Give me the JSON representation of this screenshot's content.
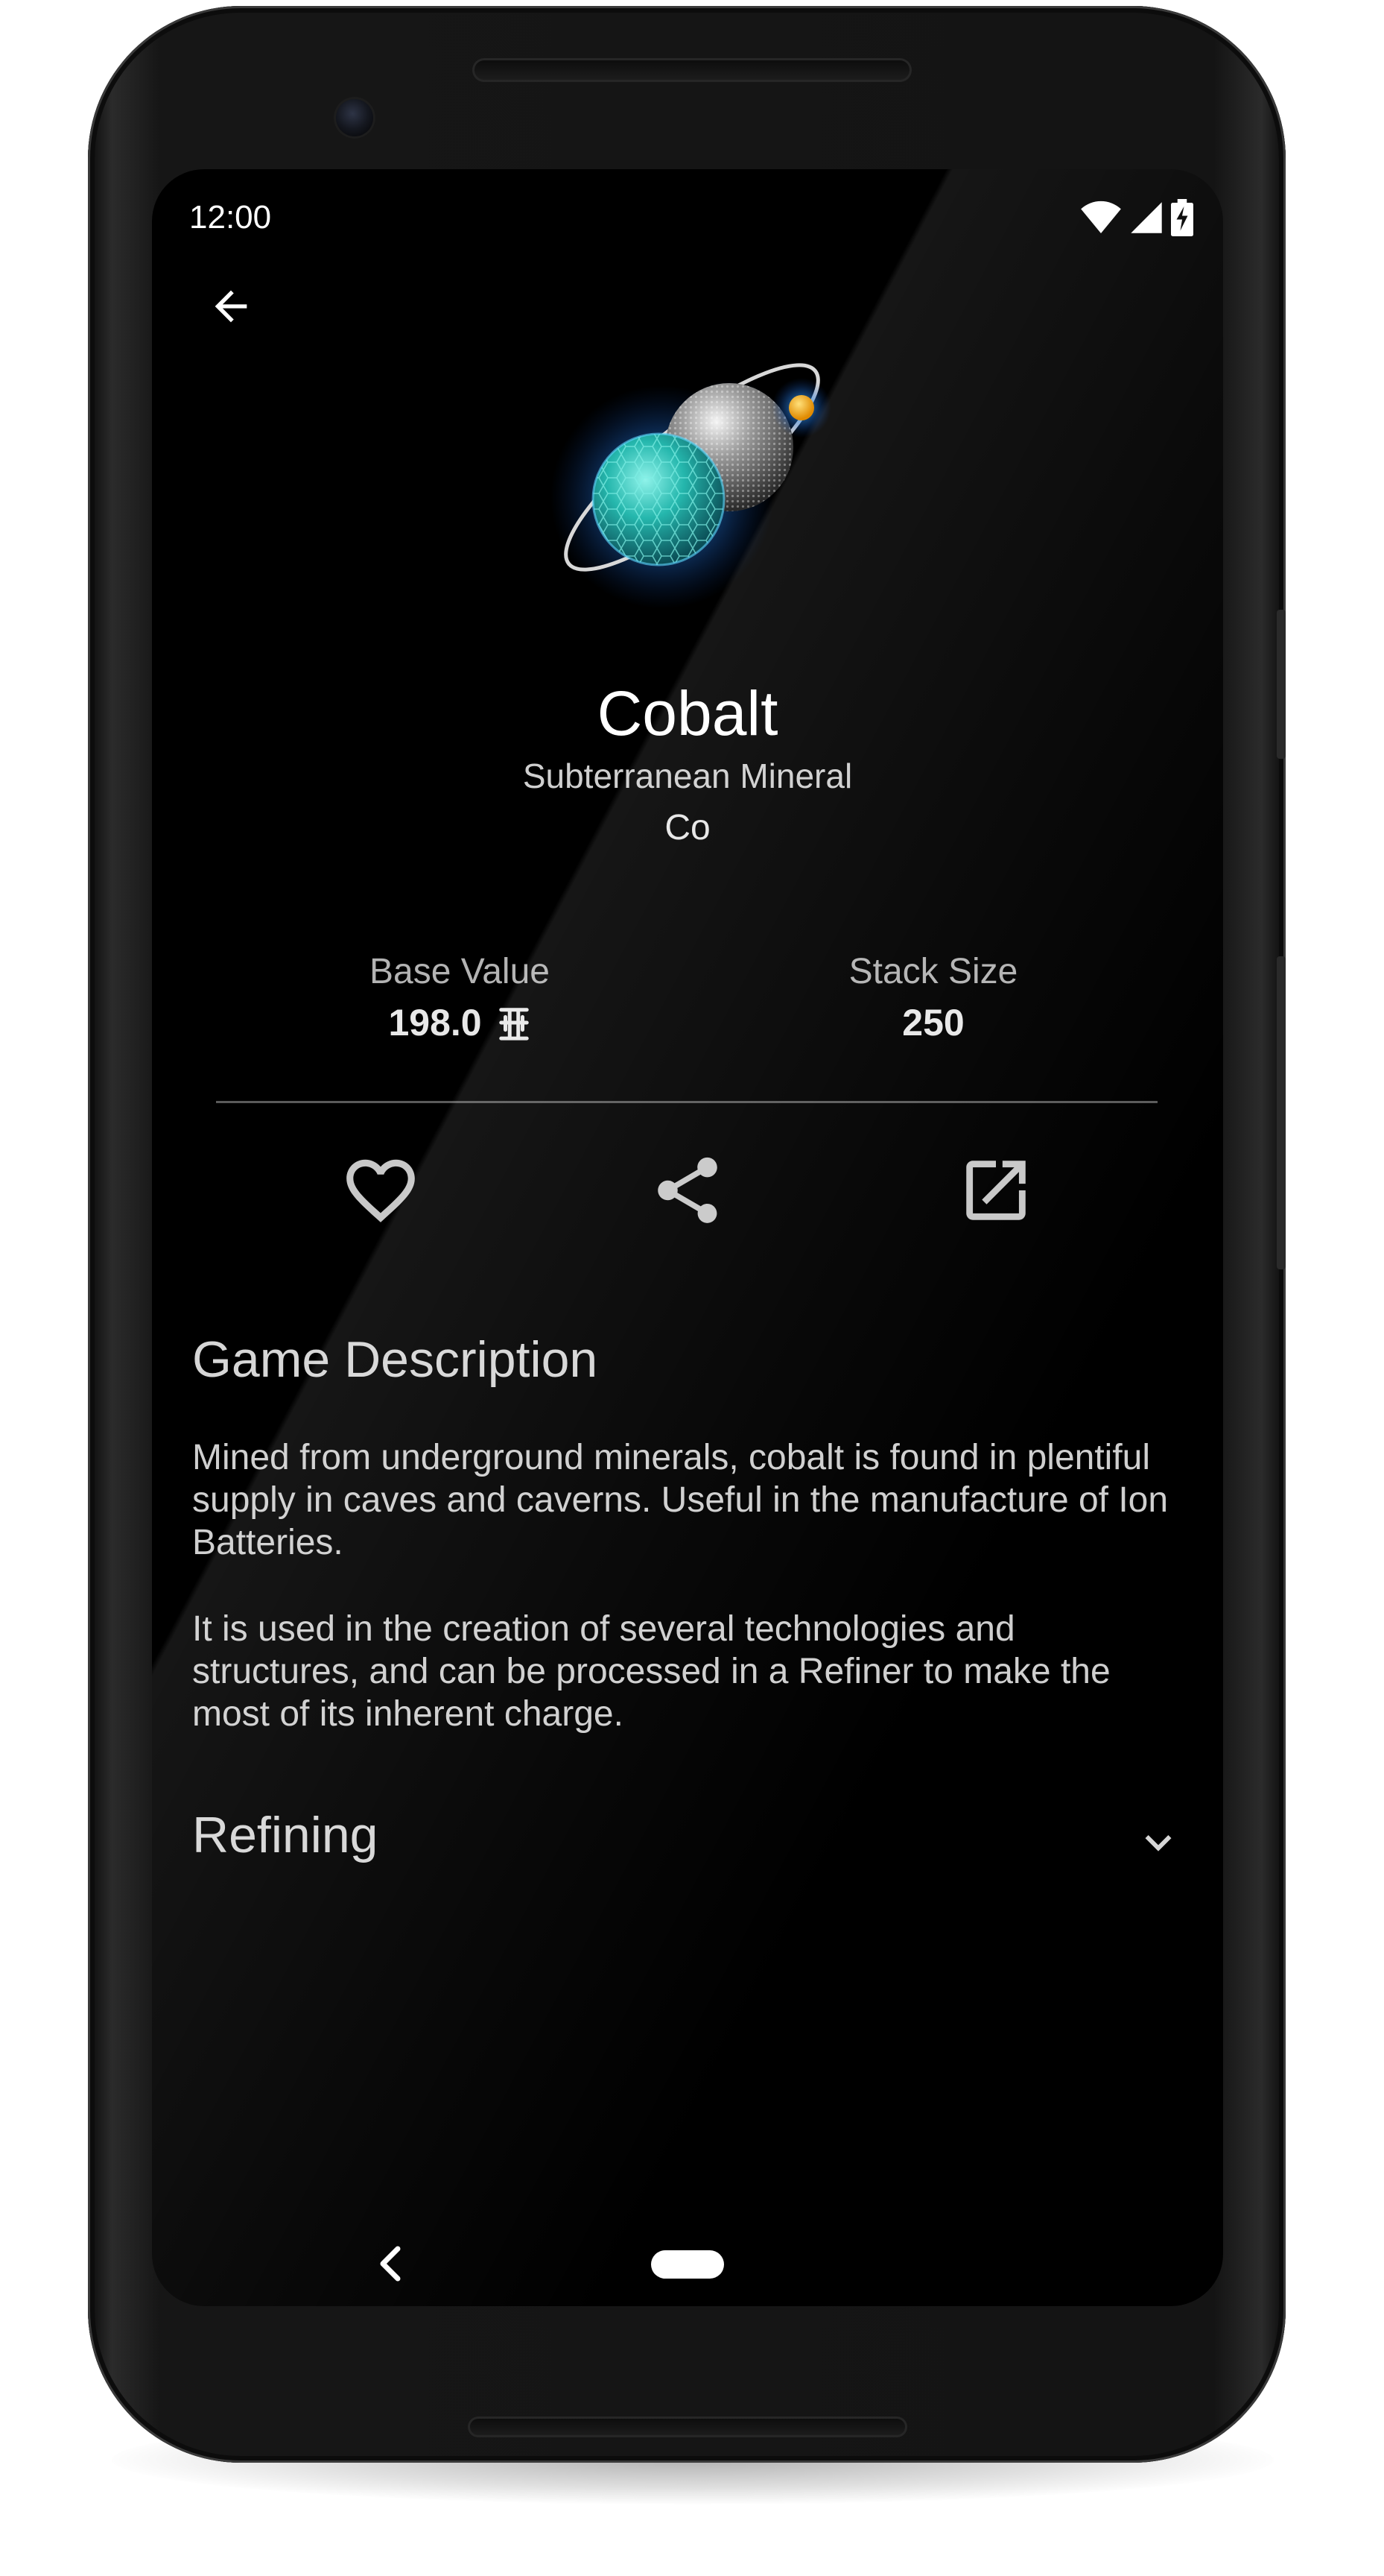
{
  "status_bar": {
    "time": "12:00",
    "icons": [
      "wifi-icon",
      "cell-signal-icon",
      "battery-charging-icon"
    ]
  },
  "toolbar": {
    "back_icon": "arrow-back-icon"
  },
  "item": {
    "image": "cobalt-atom-icon",
    "name": "Cobalt",
    "category": "Subterranean Mineral",
    "symbol": "Co"
  },
  "stats": {
    "base_value_label": "Base Value",
    "base_value": "198.0",
    "currency_icon": "units-currency-icon",
    "stack_size_label": "Stack Size",
    "stack_size": "250"
  },
  "actions": [
    {
      "icon": "heart-outline-icon"
    },
    {
      "icon": "share-icon"
    },
    {
      "icon": "open-external-icon"
    }
  ],
  "description": {
    "title": "Game Description",
    "paragraphs": [
      "Mined from underground minerals, cobalt is found in plentiful supply in caves and caverns. Useful in the manufacture of Ion Batteries.",
      "It is used in the creation of several technologies and structures, and can be processed in a Refiner to make the most of its inherent charge."
    ]
  },
  "refining": {
    "title": "Refining",
    "expand_icon": "chevron-down-icon"
  },
  "nav_bar": {
    "back_icon": "nav-back-icon",
    "home_icon": "nav-home-pill"
  },
  "colors": {
    "screen_background": "#000000",
    "primary_text": "#ffffff",
    "secondary_text": "#cfcfcf",
    "device_frame": "#161616"
  }
}
